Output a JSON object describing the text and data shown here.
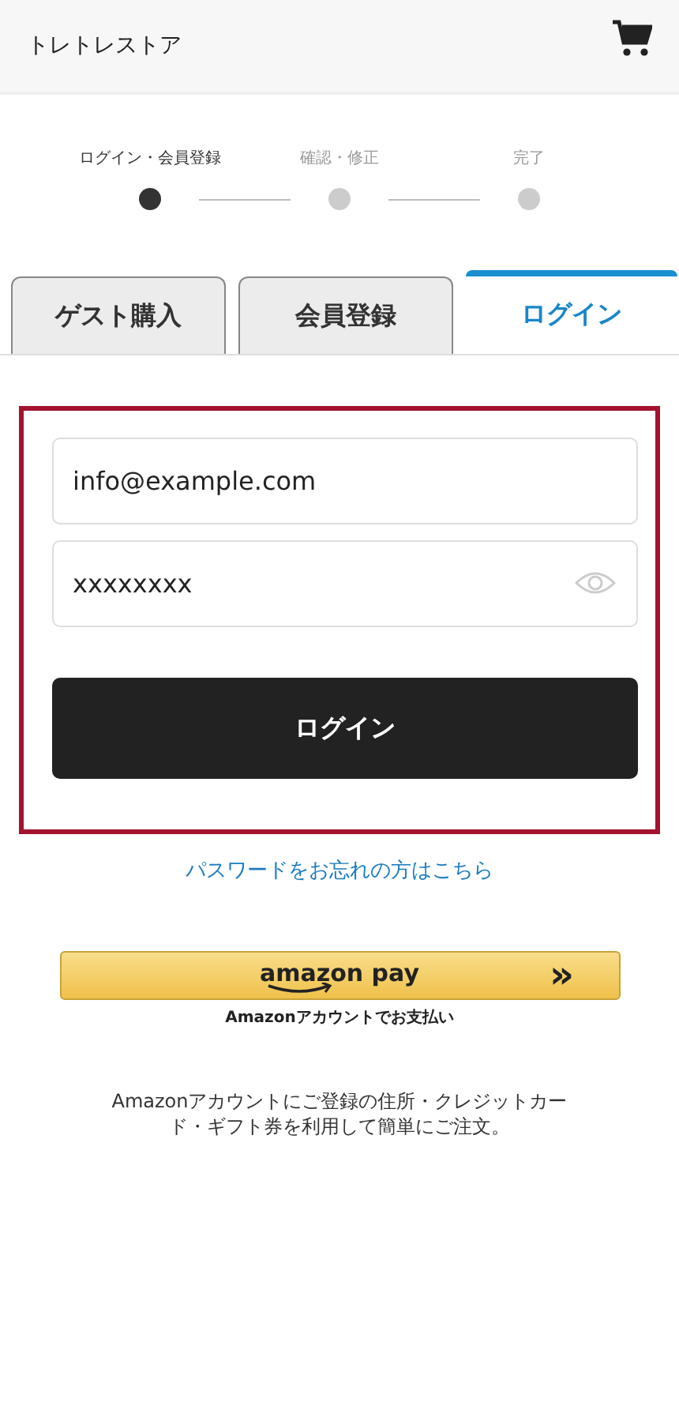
{
  "header": {
    "title": "トレトレストア"
  },
  "steps": [
    {
      "label": "ログイン・会員登録",
      "selected": true
    },
    {
      "label": "確認・修正",
      "selected": false
    },
    {
      "label": "完了",
      "selected": false
    }
  ],
  "tabs": [
    {
      "label": "ゲスト購入",
      "selected": false
    },
    {
      "label": "会員登録",
      "selected": false
    },
    {
      "label": "ログイン",
      "selected": true
    }
  ],
  "login_form": {
    "email": {
      "value": "info@example.com"
    },
    "password": {
      "value": "xxxxxxxx"
    },
    "submit": "ログイン"
  },
  "forgot_link": "パスワードをお忘れの方はこちら",
  "amazon_pay": {
    "button": "amazon pay",
    "arrow": "»",
    "caption": "Amazonアカウントでお支払い",
    "description": [
      "Amazonアカウントにご登録の住所・クレジットカー",
      "ド・ギフト券を利用して簡単にご注文。"
    ]
  }
}
